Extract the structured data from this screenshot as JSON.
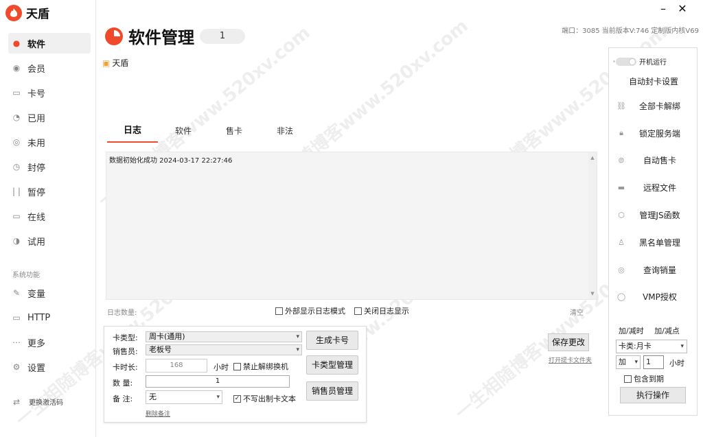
{
  "app": {
    "name": "天盾"
  },
  "window": {
    "minimize": "–",
    "close": "✕"
  },
  "version_info": "端口：3085  当前版本V:746 定制版内核V69",
  "sidebar": {
    "items": [
      {
        "label": "软件",
        "icon": "pie-icon"
      },
      {
        "label": "会员",
        "icon": "member-icon"
      },
      {
        "label": "卡号",
        "icon": "card-icon"
      },
      {
        "label": "已用",
        "icon": "used-icon"
      },
      {
        "label": "未用",
        "icon": "unused-icon"
      },
      {
        "label": "封停",
        "icon": "clock-icon"
      },
      {
        "label": "暂停",
        "icon": "pause-icon"
      },
      {
        "label": "在线",
        "icon": "monitor-icon"
      },
      {
        "label": "试用",
        "icon": "trial-icon"
      }
    ],
    "section_title": "系统功能",
    "system_items": [
      {
        "label": "变量",
        "icon": "edit-icon"
      },
      {
        "label": "HTTP",
        "icon": "monitor-icon"
      },
      {
        "label": "更多",
        "icon": "more-icon"
      },
      {
        "label": "设置",
        "icon": "gear-icon"
      }
    ],
    "activate_label": "更换激活码"
  },
  "header": {
    "title": "软件管理",
    "badge": "1",
    "app_label": "天盾"
  },
  "tabs": [
    "日志",
    "软件",
    "售卡",
    "非法"
  ],
  "log": {
    "entries": [
      "数据初始化成功  2024-03-17 22:27:46"
    ],
    "count_label": "日志数量:",
    "opt_external": "外部显示日志模式",
    "opt_close": "关闭日志显示",
    "clear": "清空"
  },
  "form": {
    "card_type_label": "卡类型:",
    "card_type_value": "周卡(通用)",
    "seller_label": "销售员:",
    "seller_value": "老板号",
    "duration_label": "卡时长:",
    "duration_value": "168",
    "duration_unit": "小时",
    "forbid_unbind": "禁止解绑换机",
    "quantity_label": "数   量:",
    "quantity_value": "1",
    "remark_label": "备   注:",
    "remark_value": "无",
    "no_card_text": "不写出制卡文本",
    "delete_remark": "删除备注",
    "btn_generate": "生成卡号",
    "btn_card_type": "卡类型管理",
    "btn_seller": "销售员管理"
  },
  "save": {
    "btn": "保存更改",
    "open_log": "打开提卡文件夹"
  },
  "right_panel": {
    "autorun": "开机运行",
    "auto_block": "自动封卡设置",
    "items": [
      {
        "label": "全部卡解绑",
        "icon": "link-icon"
      },
      {
        "label": "锁定服务端",
        "icon": "lock-icon"
      },
      {
        "label": "自动售卡",
        "icon": "coin-icon"
      },
      {
        "label": "远程文件",
        "icon": "folder-icon"
      },
      {
        "label": "管理JS函数",
        "icon": "code-icon"
      },
      {
        "label": "黑名单管理",
        "icon": "user-icon"
      },
      {
        "label": "查询销量",
        "icon": "search-icon"
      },
      {
        "label": "VMP授权",
        "icon": "shield-icon"
      }
    ],
    "add_time": "加/减时",
    "add_point": "加/减点",
    "card_class": "卡类:月卡",
    "op": "加",
    "amount": "1",
    "unit": "小时",
    "include_expired": "包含到期",
    "exec": "执行操作"
  },
  "watermark": "一生相随博客www.520xv.com",
  "colors": {
    "accent": "#ef4a2b"
  }
}
